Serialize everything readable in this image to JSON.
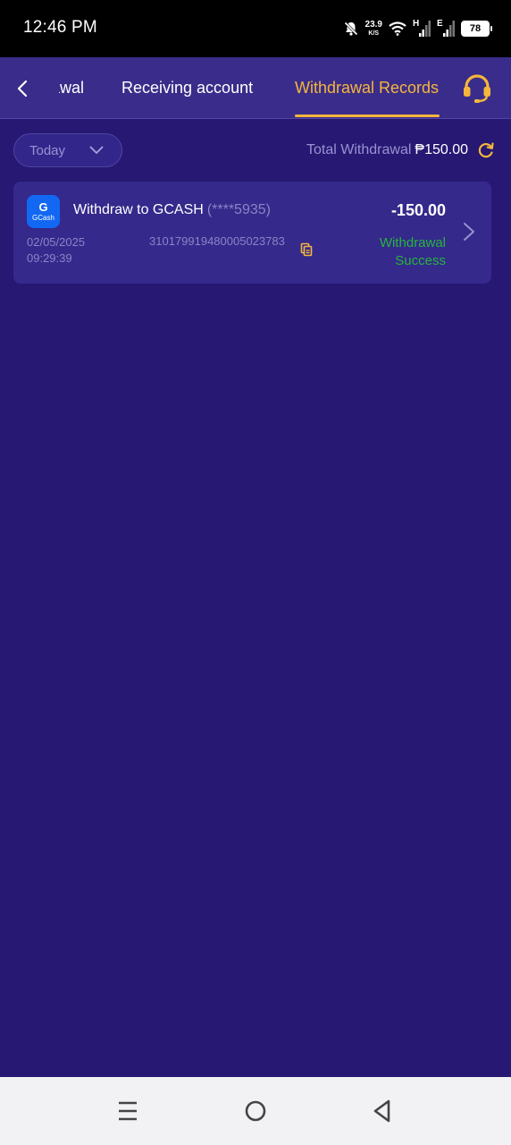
{
  "status_bar": {
    "time": "12:46 PM",
    "net_speed_value": "23.9",
    "net_speed_unit": "K/S",
    "sim1_label": "H",
    "sim2_label": "E",
    "battery": "78",
    "icons": [
      "mute-icon",
      "wifi-icon",
      "signal-icon",
      "signal-icon",
      "battery-icon"
    ]
  },
  "header": {
    "tabs": [
      {
        "label": "Withdrawal"
      },
      {
        "label": "Receiving account"
      },
      {
        "label": "Withdrawal Records",
        "active": true
      }
    ],
    "icons": [
      "chevron-left-icon",
      "headset-icon"
    ],
    "accent_color": "#f4b63c"
  },
  "filter": {
    "date_selected": "Today",
    "total_label": "Total Withdrawal",
    "total_amount": "₱150.00",
    "icons": [
      "chevron-down-icon",
      "refresh-icon"
    ]
  },
  "records": [
    {
      "method_logo_text": "G",
      "method_logo_caption": "GCash",
      "title": "Withdraw to GCASH",
      "account_masked": "(****5935)",
      "amount": "-150.00",
      "date": "02/05/2025",
      "time": "09:29:39",
      "transaction_id": "310179919480005023783",
      "status_line1": "Withdrawal",
      "status_line2": "Success",
      "status_color": "#24b53e"
    }
  ],
  "nav_bar": {
    "icons": [
      "menu-icon",
      "home-icon",
      "back-icon"
    ]
  },
  "colors": {
    "background": "#261873",
    "header": "#3a2c8a",
    "card": "#35298b"
  }
}
